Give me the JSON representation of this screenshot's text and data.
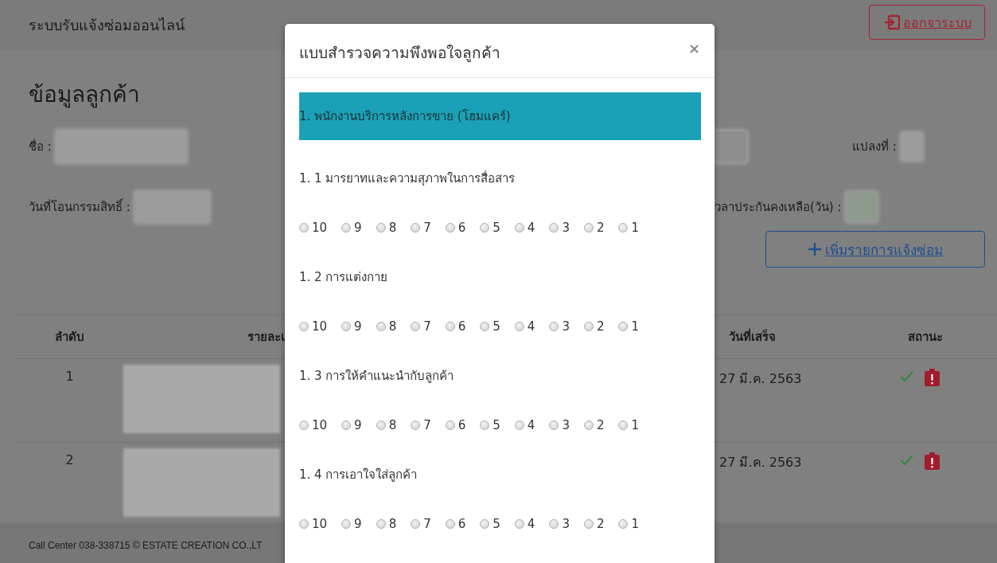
{
  "navbar": {
    "title": "ระบบรับแจ้งซ่อมออนไลน์",
    "logout_button": "ออกจาระบบ"
  },
  "customer": {
    "heading": "ข้อมูลลูกค้า",
    "rows": [
      {
        "left": "ชื่อ :",
        "right": "แปลงที่ :"
      },
      {
        "left": "วันที่โอนกรรมสิทธิ์ :",
        "right": "วลาประกันคงเหลือ(วัน) :"
      }
    ]
  },
  "add_button": "เพิ่มรายการแจ้งซ่อม",
  "table": {
    "columns": [
      "ลำดับ",
      "รายละเ",
      "วันที่เสร็จ",
      "สถานะ"
    ],
    "rows": [
      {
        "number": "1",
        "completed": "27 มี.ค. 2563"
      },
      {
        "number": "2",
        "completed": "27 มี.ค. 2563"
      }
    ]
  },
  "footer": "Call Center 038-338715 © ESTATE CREATION CO.,LT",
  "survey": {
    "title": "แบบสำรวจความพึงพอใจลูกค้า",
    "close": "×",
    "sections": [
      {
        "title": "1. พนักงานบริการหลังการขาย (โฮมแคร์)",
        "questions": [
          {
            "label": "1. 1 มารยาทและความสุภาพในการสื่อสาร",
            "options": [
              {
                "label": "10",
                "selected": false
              },
              {
                "label": "9",
                "selected": false
              },
              {
                "label": "8",
                "selected": false
              },
              {
                "label": "7",
                "selected": false
              },
              {
                "label": "6",
                "selected": false
              },
              {
                "label": "5",
                "selected": false
              },
              {
                "label": "4",
                "selected": false
              },
              {
                "label": "3",
                "selected": false
              },
              {
                "label": "2",
                "selected": false
              },
              {
                "label": "1",
                "selected": false
              }
            ]
          },
          {
            "label": "1. 2 การแต่งกาย",
            "options": [
              {
                "label": "10",
                "selected": false
              },
              {
                "label": "9",
                "selected": false
              },
              {
                "label": "8",
                "selected": false
              },
              {
                "label": "7",
                "selected": false
              },
              {
                "label": "6",
                "selected": false
              },
              {
                "label": "5",
                "selected": false
              },
              {
                "label": "4",
                "selected": false
              },
              {
                "label": "3",
                "selected": false
              },
              {
                "label": "2",
                "selected": false
              },
              {
                "label": "1",
                "selected": false
              }
            ]
          },
          {
            "label": "1. 3 การให้คำแนะนำกับลูกค้า",
            "options": [
              {
                "label": "10",
                "selected": false
              },
              {
                "label": "9",
                "selected": false
              },
              {
                "label": "8",
                "selected": false
              },
              {
                "label": "7",
                "selected": false
              },
              {
                "label": "6",
                "selected": false
              },
              {
                "label": "5",
                "selected": false
              },
              {
                "label": "4",
                "selected": false
              },
              {
                "label": "3",
                "selected": false
              },
              {
                "label": "2",
                "selected": false
              },
              {
                "label": "1",
                "selected": false
              }
            ]
          },
          {
            "label": "1. 4 การเอาใจใส่ลูกค้า",
            "options": [
              {
                "label": "10",
                "selected": false
              },
              {
                "label": "9",
                "selected": false
              },
              {
                "label": "8",
                "selected": false
              },
              {
                "label": "7",
                "selected": false
              },
              {
                "label": "6",
                "selected": false
              },
              {
                "label": "5",
                "selected": false
              },
              {
                "label": "4",
                "selected": false
              },
              {
                "label": "3",
                "selected": false
              },
              {
                "label": "2",
                "selected": false
              },
              {
                "label": "1",
                "selected": false
              }
            ]
          }
        ]
      }
    ]
  }
}
